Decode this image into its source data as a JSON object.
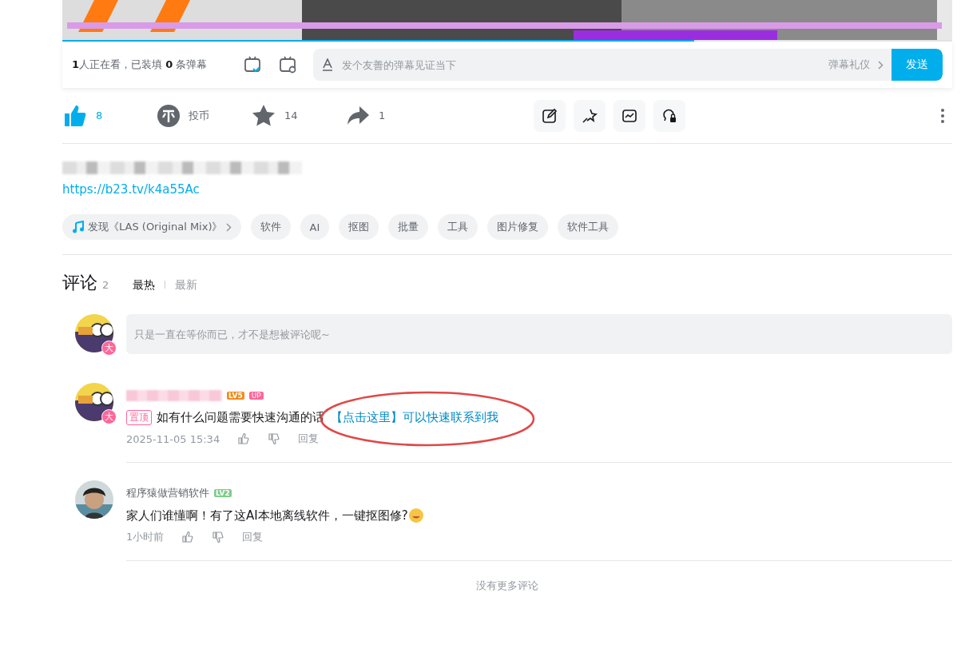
{
  "player": {
    "progress": {
      "level": 0.71
    },
    "viewers": "**1**人正在看，已装填 **0** 条弹幕",
    "danmaku_input": {
      "placeholder": "发个友善的弹幕见证当下"
    },
    "etiquette": "弹幕礼仪",
    "send": "发送"
  },
  "actions": [
    {
      "kind": "like",
      "count": "8",
      "selected": true
    },
    {
      "kind": "coin",
      "count": "投币",
      "selected": false
    },
    {
      "kind": "favorite",
      "count": "14",
      "selected": false
    },
    {
      "kind": "share",
      "count": "1",
      "selected": false
    }
  ],
  "description": {
    "link": "https://b23.tv/k4a55Ac"
  },
  "tags": [
    {
      "kind": "music",
      "label": "发现《LAS (Original Mix)》"
    },
    {
      "kind": "tag",
      "label": "软件"
    },
    {
      "kind": "tag",
      "label": "AI"
    },
    {
      "kind": "tag",
      "label": "抠图"
    },
    {
      "kind": "tag",
      "label": "批量"
    },
    {
      "kind": "tag",
      "label": "工具"
    },
    {
      "kind": "tag",
      "label": "图片修复"
    },
    {
      "kind": "tag",
      "label": "软件工具"
    }
  ],
  "comments": {
    "title": "评论",
    "count": "2",
    "sort": [
      {
        "label": "最热",
        "selected": true
      },
      {
        "label": "最新",
        "selected": false
      }
    ],
    "input": {
      "placeholder": "只是一直在等你而已，才不是想被评论呢~",
      "vip_badge": "大"
    },
    "items": [
      {
        "vip_badge": "大",
        "rank_badge": {
          "text": "LV5",
          "color": "#f28a1e"
        },
        "up_badge": "UP",
        "pinned": "置顶",
        "text": "如有什么问题需要快速沟通的话",
        "link": "【点击这里】可以快速联系到我",
        "circled": true,
        "time": "2025-11-05 15:34",
        "reply": "回复"
      },
      {
        "name": "程序猿做营销软件",
        "rank_badge": {
          "text": "LV2",
          "color": "#7fcc8a"
        },
        "text": "家人们谁懂啊！有了这AI本地离线软件，一键抠图修?",
        "circled": false,
        "emoji": true,
        "time": "1小时前",
        "reply": "回复"
      }
    ],
    "end": "没有更多评论"
  }
}
